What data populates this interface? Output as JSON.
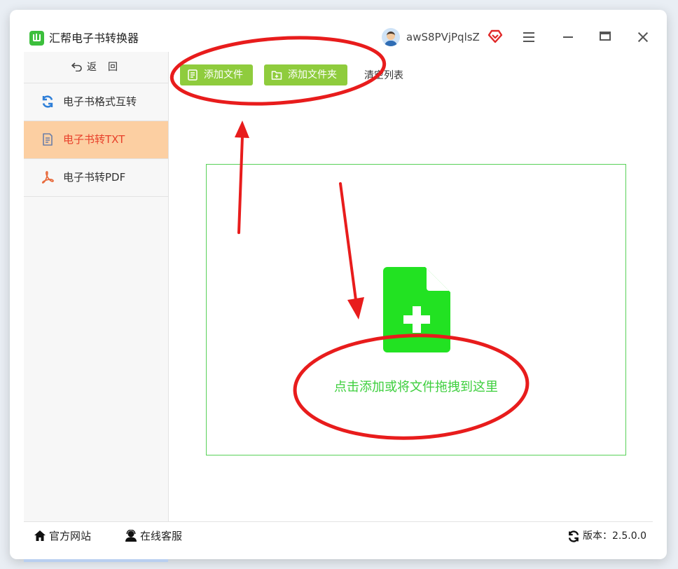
{
  "app": {
    "title": "汇帮电子书转换器",
    "username": "awS8PVjPqlsZ"
  },
  "colors": {
    "accent_green": "#8fcc3d",
    "active_nav_bg": "#fccfa2",
    "active_nav_text": "#e8402a",
    "drop_green": "#3dcf3d",
    "annotation_red": "#e81c1c"
  },
  "sidebar": {
    "back_label": "返回",
    "items": [
      {
        "label": "电子书格式互转",
        "icon": "refresh-icon",
        "active": false
      },
      {
        "label": "电子书转TXT",
        "icon": "document-icon",
        "active": true
      },
      {
        "label": "电子书转PDF",
        "icon": "pdf-icon",
        "active": false
      }
    ]
  },
  "toolbar": {
    "add_file_label": "添加文件",
    "add_folder_label": "添加文件夹",
    "clear_list_label": "清空列表"
  },
  "dropzone": {
    "text": "点击添加或将文件拖拽到这里",
    "icon": "file-plus-icon"
  },
  "footer": {
    "website_label": "官方网站",
    "support_label": "在线客服",
    "version_label": "版本：2.5.0.0"
  }
}
